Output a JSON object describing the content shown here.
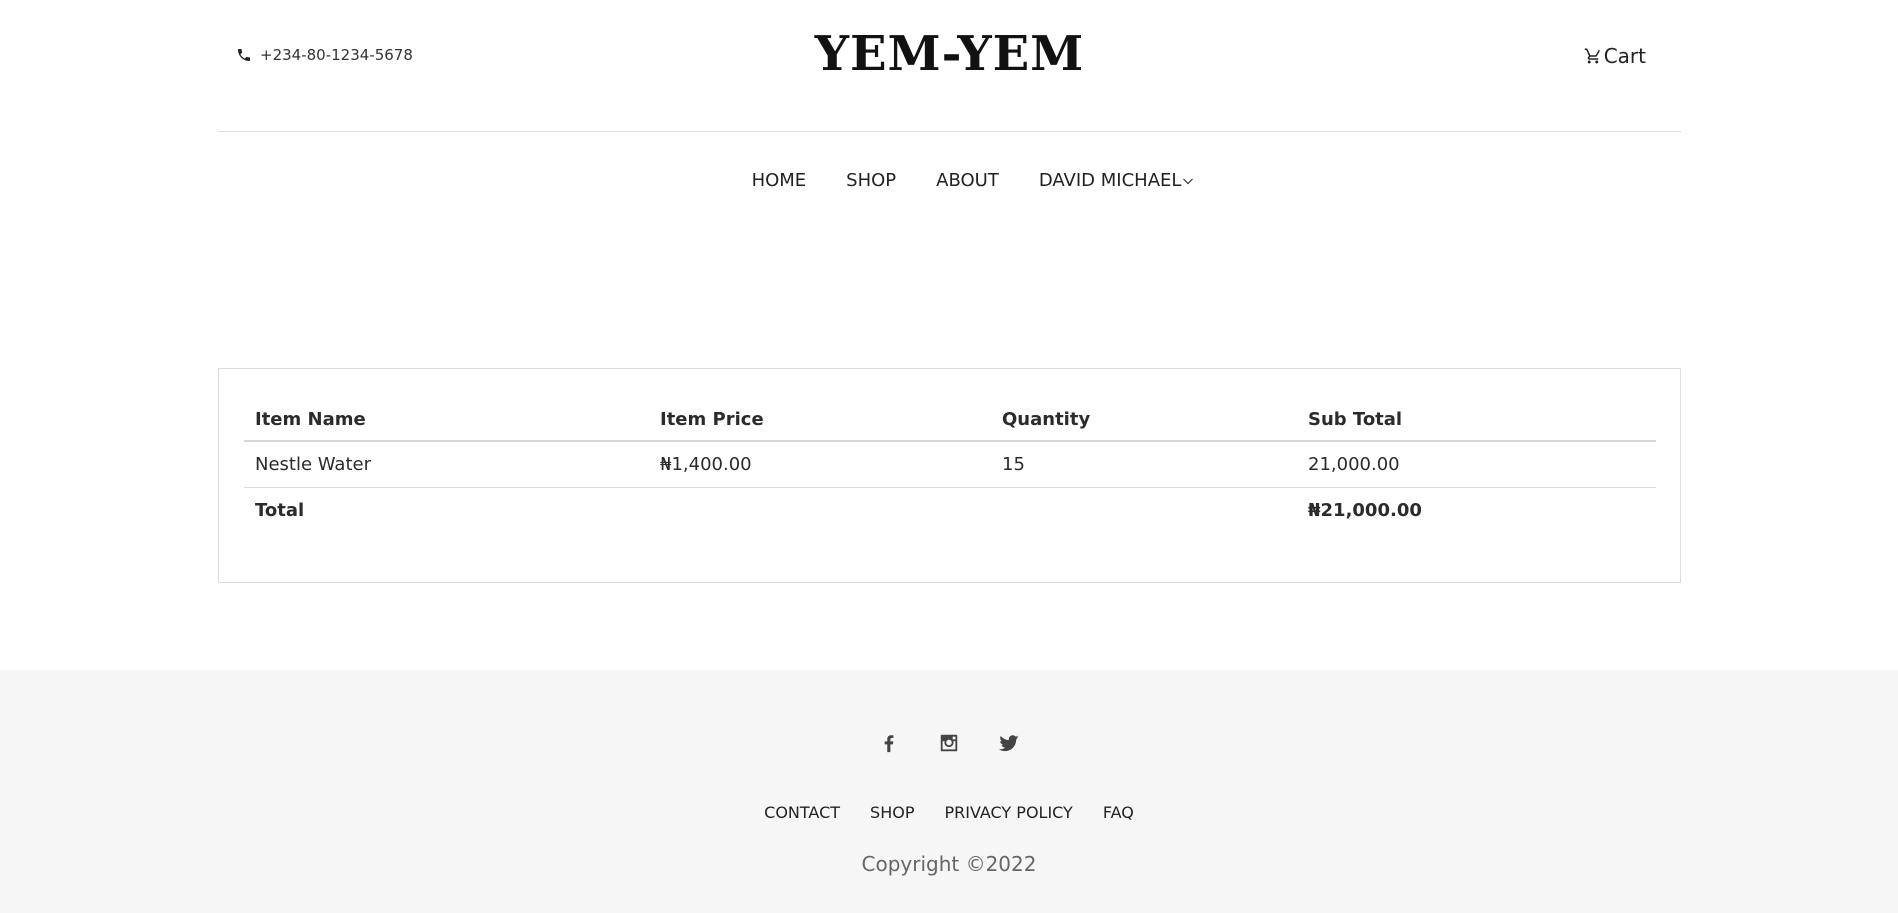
{
  "header": {
    "phone": "+234-80-1234-5678",
    "phone_icon": "phone-icon",
    "brand": "YEM-YEM",
    "cart_label": "Cart",
    "cart_icon": "shopping-cart-icon"
  },
  "nav": {
    "items": [
      {
        "label": "HOME"
      },
      {
        "label": "SHOP"
      },
      {
        "label": "ABOUT"
      },
      {
        "label": "DAVID MICHAEL",
        "icon": "chevron-down-icon"
      }
    ]
  },
  "cart_table": {
    "headers": [
      "Item Name",
      "Item Price",
      "Quantity",
      "Sub Total"
    ],
    "rows": [
      {
        "name": "Nestle Water",
        "price": "₦1,400.00",
        "quantity": "15",
        "subtotal": "21,000.00"
      }
    ],
    "total_label": "Total",
    "total_value": "₦21,000.00"
  },
  "footer": {
    "social": [
      "facebook-icon",
      "instagram-icon",
      "twitter-icon"
    ],
    "links": [
      "CONTACT",
      "SHOP",
      "PRIVACY POLICY",
      "FAQ"
    ],
    "copyright": "Copyright ©2022"
  },
  "colors": {
    "footer_bg": "#f6f6f6",
    "border": "#dcdcdc",
    "text": "#2b2b2b"
  }
}
